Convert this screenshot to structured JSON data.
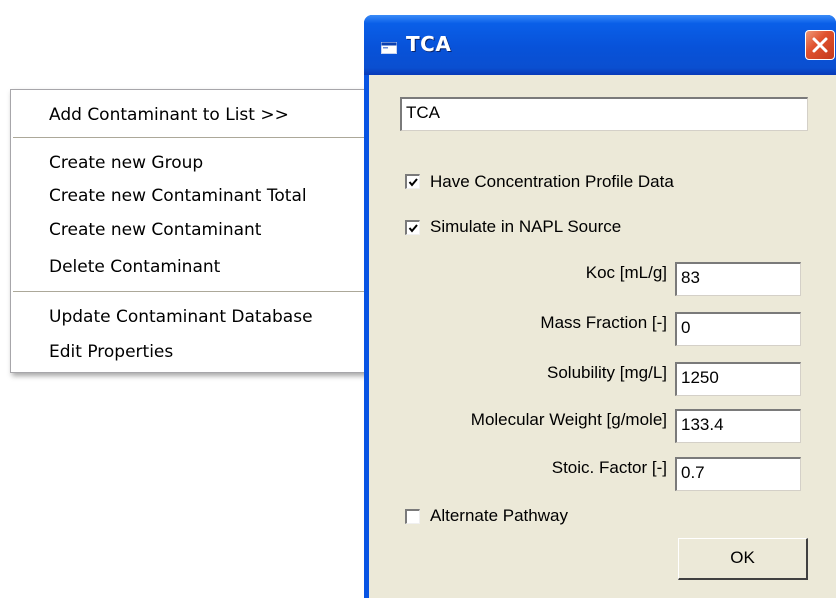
{
  "context_menu": {
    "items": [
      {
        "label": "Add Contaminant to List >>"
      },
      {
        "label": "Create new Group"
      },
      {
        "label": "Create new Contaminant Total"
      },
      {
        "label": "Create new Contaminant"
      },
      {
        "label": "Delete Contaminant"
      },
      {
        "label": "Update Contaminant Database"
      },
      {
        "label": "Edit Properties"
      }
    ]
  },
  "dialog": {
    "title": "TCA",
    "title_icon": "window-icon",
    "close_icon": "close-icon",
    "name_value": "TCA",
    "checkboxes": {
      "concentration_profile": {
        "label": "Have Concentration Profile Data",
        "checked": true
      },
      "simulate_napl": {
        "label": "Simulate in NAPL Source",
        "checked": true
      },
      "alternate_pathway": {
        "label": "Alternate Pathway",
        "checked": false
      }
    },
    "fields": [
      {
        "label": "Koc [mL/g]",
        "value": "83"
      },
      {
        "label": "Mass Fraction [-]",
        "value": "0"
      },
      {
        "label": "Solubility [mg/L]",
        "value": "1250"
      },
      {
        "label": "Molecular Weight [g/mole]",
        "value": "133.4"
      },
      {
        "label": "Stoic. Factor [-]",
        "value": "0.7"
      }
    ],
    "ok_label": "OK"
  },
  "colors": {
    "titlebar": "#0852d9",
    "client_bg": "#ece9d8",
    "close_button": "#e0522e"
  }
}
